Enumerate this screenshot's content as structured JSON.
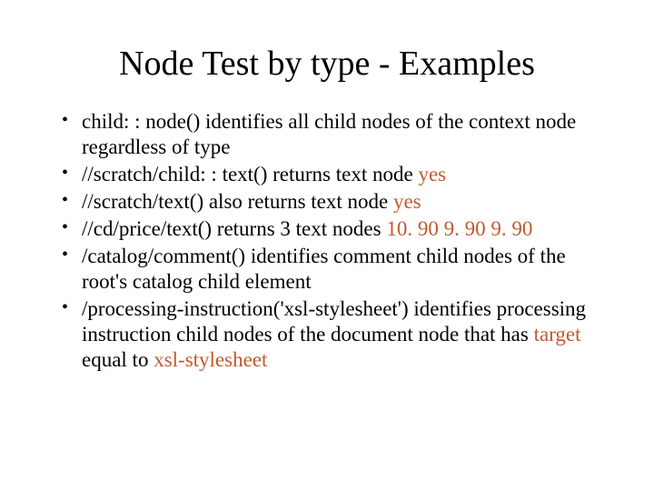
{
  "title": "Node Test by type - Examples",
  "items": [
    {
      "t0": "child: : node() identifies all child nodes of the context node regardless of type"
    },
    {
      "t0": "//scratch/child: : text() returns text node ",
      "h0": "yes"
    },
    {
      "t0": "//scratch/text() also returns text node ",
      "h0": "yes"
    },
    {
      "t0": "//cd/price/text() returns 3 text nodes ",
      "h0": "10. 90 9. 90 9. 90"
    },
    {
      "t0": "/catalog/comment() identifies comment child nodes of the root's catalog child element"
    },
    {
      "t0": "/processing-instruction('xsl-stylesheet') identifies processing instruction child nodes of the document node that has ",
      "h0": "target",
      "t1": " equal to ",
      "h1": "xsl-stylesheet"
    }
  ]
}
